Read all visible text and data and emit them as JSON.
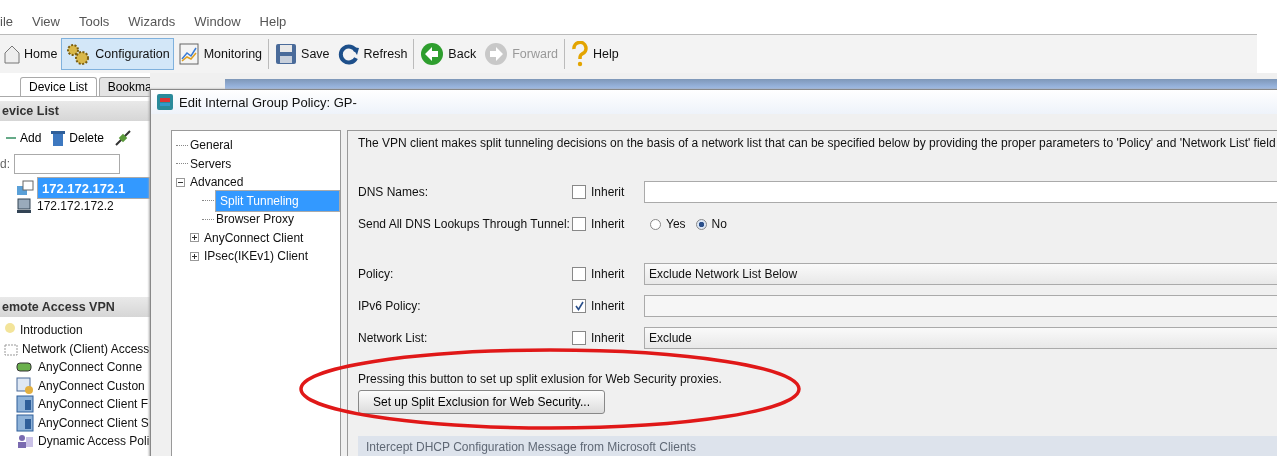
{
  "menu_bar": [
    "ile",
    "View",
    "Tools",
    "Wizards",
    "Window",
    "Help"
  ],
  "toolbar": [
    {
      "kind": "home",
      "label": "Home",
      "selected": false,
      "disabled": false
    },
    {
      "kind": "gears",
      "label": "Configuration",
      "selected": true,
      "disabled": false
    },
    {
      "kind": "chart",
      "label": "Monitoring",
      "selected": false,
      "disabled": false
    },
    {
      "kind": "save",
      "label": "Save",
      "selected": false,
      "disabled": false
    },
    {
      "kind": "refresh",
      "label": "Refresh",
      "selected": false,
      "disabled": false
    },
    {
      "kind": "back",
      "label": "Back",
      "selected": false,
      "disabled": false
    },
    {
      "kind": "forward",
      "label": "Forward",
      "selected": false,
      "disabled": true
    },
    {
      "kind": "help",
      "label": "Help",
      "selected": false,
      "disabled": false
    }
  ],
  "left_tabs": [
    {
      "label": "Device List",
      "selected": true
    },
    {
      "label": "Bookma",
      "selected": false
    }
  ],
  "device_list": {
    "title": "evice List",
    "actions": [
      {
        "kind": "add",
        "label": "Add"
      },
      {
        "kind": "delete",
        "label": "Delete"
      },
      {
        "kind": "connect"
      }
    ],
    "find_label": "d:",
    "devices": [
      {
        "kind": "active",
        "label": "172.172.172.1",
        "selected": true
      },
      {
        "kind": "device",
        "label": "172.172.172.2",
        "selected": false
      }
    ]
  },
  "remote_access_vpn": {
    "title": "emote Access VPN",
    "items": [
      {
        "kind": "bulb",
        "label": "Introduction"
      },
      {
        "kind": "folder",
        "label": "Network (Client) Access"
      },
      {
        "kind": "plug",
        "label": "AnyConnect Conne"
      },
      {
        "kind": "custom",
        "label": "AnyConnect Custon"
      },
      {
        "kind": "doc",
        "label": "AnyConnect Client F"
      },
      {
        "kind": "doc",
        "label": "AnyConnect Client S"
      },
      {
        "kind": "policy",
        "label": "Dynamic Access Poli"
      }
    ]
  },
  "dialog": {
    "title": "Edit Internal Group Policy: GP-",
    "tree": [
      {
        "label": "General",
        "selected": false
      },
      {
        "label": "Servers",
        "selected": false
      },
      {
        "label": "Advanced",
        "selected": false,
        "expanded": true,
        "children": [
          {
            "label": "Split Tunneling",
            "selected": true
          },
          {
            "label": "Browser Proxy",
            "selected": false
          },
          {
            "label": "AnyConnect Client",
            "selected": false,
            "expanded": false
          },
          {
            "label": "IPsec(IKEv1) Client",
            "selected": false,
            "expanded": false
          }
        ]
      }
    ],
    "description": "The VPN client makes split tunneling decisions on the basis of a network list that can be specified below by providing the proper parameters to 'Policy' and 'Network List' field",
    "settings": [
      {
        "kind": "text",
        "label": "DNS Names:",
        "inherit_label": "Inherit",
        "inherit": false
      },
      {
        "kind": "radio",
        "label": "Send All DNS Lookups Through Tunnel:",
        "inherit_label": "Inherit",
        "inherit": false,
        "options": [
          {
            "label": "Yes",
            "selected": false
          },
          {
            "label": "No",
            "selected": true
          }
        ]
      },
      {
        "kind": "select",
        "label": "Policy:",
        "inherit_label": "Inherit",
        "inherit": false,
        "value": "Exclude Network List Below"
      },
      {
        "kind": "select",
        "label": "IPv6 Policy:",
        "inherit_label": "Inherit",
        "inherit": true
      },
      {
        "kind": "select",
        "label": "Network List:",
        "inherit_label": "Inherit",
        "inherit": false,
        "value": "Exclude"
      }
    ],
    "exclusion_note": "Pressing this button to set up split exlusion for Web Security proxies.",
    "exclusion_button": "Set up Split Exclusion for Web Security...",
    "section": "Intercept DHCP Configuration Message from Microsoft Clients"
  }
}
